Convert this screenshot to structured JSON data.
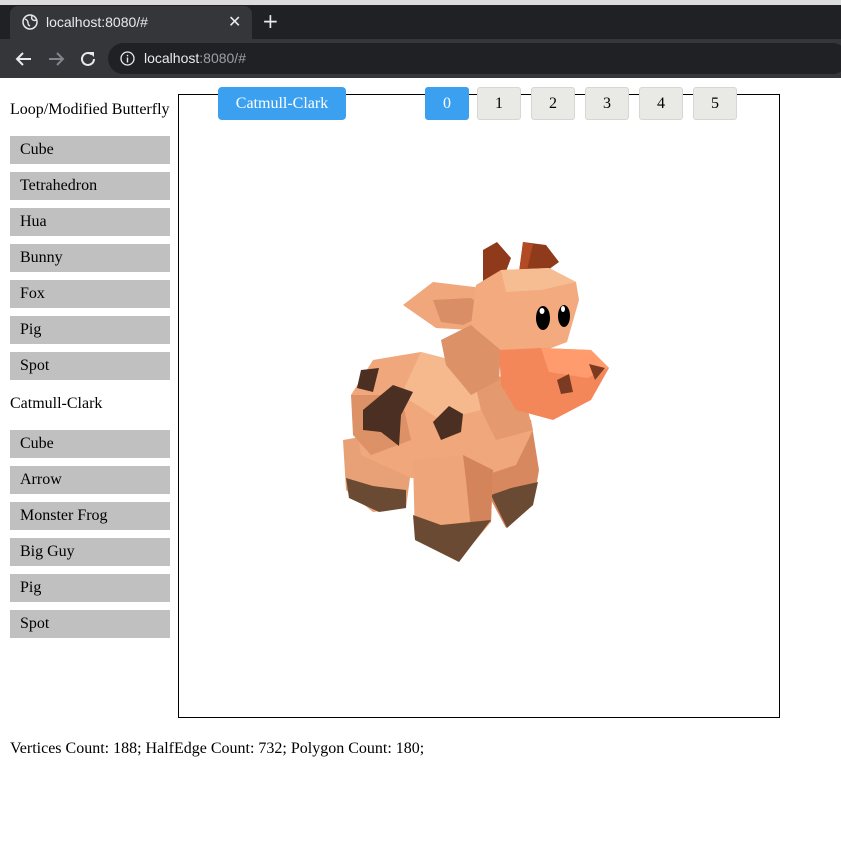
{
  "browser": {
    "tab_title": "localhost:8080/#",
    "tab_close": "✕",
    "new_tab": "+",
    "url_host": "localhost",
    "url_rest": ":8080/#"
  },
  "sidebar": {
    "loop_heading": "Loop/Modified Butterfly",
    "loop_items": [
      "Cube",
      "Tetrahedron",
      "Hua",
      "Bunny",
      "Fox",
      "Pig",
      "Spot"
    ],
    "catmull_heading": "Catmull-Clark",
    "catmull_items": [
      "Cube",
      "Arrow",
      "Monster Frog",
      "Big Guy",
      "Pig",
      "Spot"
    ]
  },
  "toolbar": {
    "mode_label": "Catmull-Clark",
    "levels": [
      "0",
      "1",
      "2",
      "3",
      "4",
      "5"
    ],
    "active_level": "0"
  },
  "stats": {
    "text": "Vertices Count: 188; HalfEdge Count: 732; Polygon Count: 180;"
  },
  "colors": {
    "accent": "#3ca0f0",
    "sidebar_button": "#c0c0c0",
    "level_button": "#e9e9e5"
  },
  "scene": {
    "model": "low-poly cow (Spot)"
  }
}
